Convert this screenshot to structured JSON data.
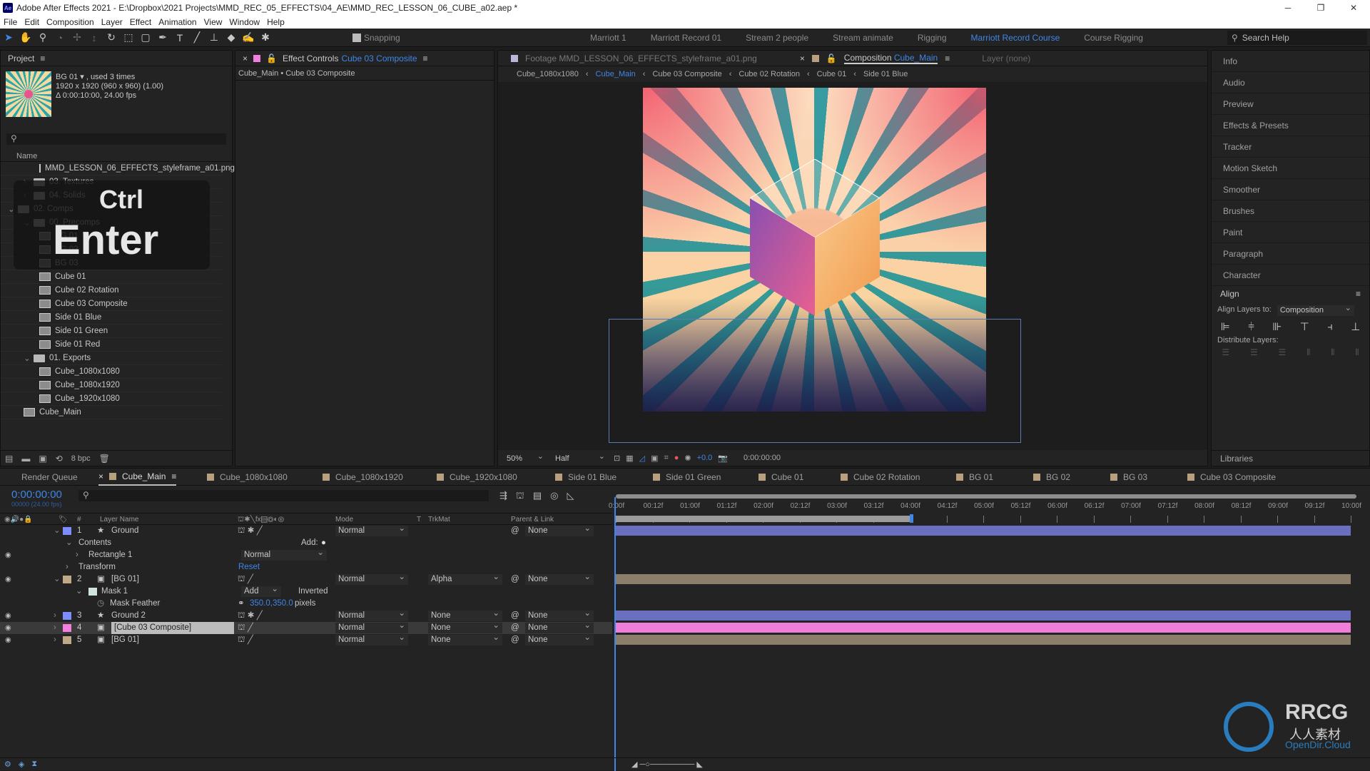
{
  "app": {
    "title": "Adobe After Effects 2021 - E:\\Dropbox\\2021 Projects\\MMD_REC_05_EFFECTS\\04_AE\\MMD_REC_LESSON_06_CUBE_a02.aep *",
    "logo": "Ae"
  },
  "menu": [
    "File",
    "Edit",
    "Composition",
    "Layer",
    "Effect",
    "Animation",
    "View",
    "Window",
    "Help"
  ],
  "toolbar": {
    "snapping": "Snapping",
    "workspaces": [
      "Marriott 1",
      "Marriott Record 01",
      "Stream 2 people",
      "Stream animate",
      "Rigging",
      "Marriott Record Course",
      "Course Rigging"
    ],
    "active_workspace": "Marriott Record Course",
    "search_help": "Search Help"
  },
  "project": {
    "title": "Project",
    "selected_name": "BG 01",
    "used": ", used 3 times",
    "dims": "1920 x 1920  (960 x 960) (1.00)",
    "duration": "Δ 0:00:10:00, 24.00 fps",
    "name_header": "Name",
    "bpc": "8 bpc",
    "items": [
      {
        "label": "MMD_LESSON_06_EFFECTS_styleframe_a01.png",
        "type": "footage",
        "indent": 2
      },
      {
        "label": "03. Textures",
        "type": "folder",
        "indent": 1
      },
      {
        "label": "04. Solids",
        "type": "folder",
        "indent": 1
      },
      {
        "label": "02. Comps",
        "type": "folder",
        "indent": 0
      },
      {
        "label": "00. Precomps",
        "type": "folder",
        "indent": 1
      },
      {
        "label": "BG 01",
        "type": "comp",
        "indent": 2
      },
      {
        "label": "BG 02",
        "type": "comp",
        "indent": 2
      },
      {
        "label": "BG 03",
        "type": "comp",
        "indent": 2
      },
      {
        "label": "Cube 01",
        "type": "comp",
        "indent": 2
      },
      {
        "label": "Cube 02 Rotation",
        "type": "comp",
        "indent": 2
      },
      {
        "label": "Cube 03 Composite",
        "type": "comp",
        "indent": 2
      },
      {
        "label": "Side 01 Blue",
        "type": "comp",
        "indent": 2
      },
      {
        "label": "Side 01 Green",
        "type": "comp",
        "indent": 2
      },
      {
        "label": "Side 01 Red",
        "type": "comp",
        "indent": 2
      },
      {
        "label": "01. Exports",
        "type": "folder",
        "indent": 1
      },
      {
        "label": "Cube_1080x1080",
        "type": "comp",
        "indent": 2
      },
      {
        "label": "Cube_1080x1920",
        "type": "comp",
        "indent": 2
      },
      {
        "label": "Cube_1920x1080",
        "type": "comp",
        "indent": 2
      },
      {
        "label": "Cube_Main",
        "type": "comp",
        "indent": 1
      }
    ]
  },
  "overlay": {
    "key1": "Ctrl",
    "key2": "Enter"
  },
  "effect_controls": {
    "title": "Effect Controls",
    "layer": "Cube 03 Composite",
    "path": "Cube_Main • Cube 03 Composite"
  },
  "viewer": {
    "footage_tab": "Footage MMD_LESSON_06_EFFECTS_styleframe_a01.png",
    "comp_tab_prefix": "Composition",
    "comp_tab_name": "Cube_Main",
    "layer_tab": "Layer (none)",
    "breadcrumbs": [
      "Cube_1080x1080",
      "Cube_Main",
      "Cube 03 Composite",
      "Cube 02 Rotation",
      "Cube 01",
      "Side 01 Blue"
    ],
    "active_crumb": "Cube_Main",
    "zoom": "50%",
    "resolution": "Half",
    "exposure": "+0.0",
    "timecode": "0:00:00:00"
  },
  "right_panel": {
    "items": [
      "Info",
      "Audio",
      "Preview",
      "Effects & Presets",
      "Tracker",
      "Motion Sketch",
      "Smoother",
      "Brushes",
      "Paint",
      "Paragraph",
      "Character"
    ],
    "align_title": "Align",
    "align_layers_to": "Align Layers to:",
    "align_target": "Composition",
    "distribute": "Distribute Layers:",
    "libraries": "Libraries"
  },
  "timeline": {
    "tabs": [
      "Render Queue",
      "Cube_Main",
      "Cube_1080x1080",
      "Cube_1080x1920",
      "Cube_1920x1080",
      "Side 01 Blue",
      "Side 01 Green",
      "Cube 01",
      "Cube 02 Rotation",
      "BG 01",
      "BG 02",
      "BG 03",
      "Cube 03 Composite"
    ],
    "active_tab": "Cube_Main",
    "timecode": "0:00:00:00",
    "frame_info": "00000 (24.00 fps)",
    "headers": {
      "num": "#",
      "layer_name": "Layer Name",
      "mode": "Mode",
      "t": "T",
      "trkmat": "TrkMat",
      "parent": "Parent & Link"
    },
    "ruler": [
      "0:00f",
      "00:12f",
      "01:00f",
      "01:12f",
      "02:00f",
      "02:12f",
      "03:00f",
      "03:12f",
      "04:00f",
      "04:12f",
      "05:00f",
      "05:12f",
      "06:00f",
      "06:12f",
      "07:00f",
      "07:12f",
      "08:00f",
      "08:12f",
      "09:00f",
      "09:12f",
      "10:00f"
    ],
    "work_area_end": "04:00f",
    "layers": [
      {
        "num": "1",
        "name": "Ground",
        "label_color": "#7d8cff",
        "mode": "Normal",
        "trkmat": "",
        "parent": "None",
        "bar_color": "#6b6fc0",
        "star": true
      },
      {
        "num": "2",
        "name": "[BG 01]",
        "label_color": "#bfa987",
        "mode": "Normal",
        "trkmat": "Alpha",
        "parent": "None",
        "bar_color": "#8b7f6b",
        "star": false
      },
      {
        "num": "3",
        "name": "Ground 2",
        "label_color": "#7d8cff",
        "mode": "Normal",
        "trkmat": "None",
        "parent": "None",
        "bar_color": "#6b6fc0",
        "star": true
      },
      {
        "num": "4",
        "name": "[Cube 03 Composite]",
        "label_color": "#f27fe0",
        "mode": "Normal",
        "trkmat": "None",
        "parent": "None",
        "bar_color": "#f07ed8",
        "star": false
      },
      {
        "num": "5",
        "name": "[BG 01]",
        "label_color": "#bfa987",
        "mode": "Normal",
        "trkmat": "None",
        "parent": "None",
        "bar_color": "#8b7f6b",
        "star": false
      }
    ],
    "props": {
      "contents": "Contents",
      "add": "Add:",
      "rectangle": "Rectangle 1",
      "rect_mode": "Normal",
      "transform": "Transform",
      "reset": "Reset",
      "mask": "Mask 1",
      "mask_mode": "Add",
      "inverted": "Inverted",
      "feather": "Mask Feather",
      "feather_val": "350.0,350.0",
      "pixels": "pixels"
    }
  },
  "watermark": {
    "brand": "RRCG",
    "sub": "人人素材",
    "site": "OpenDir.Cloud"
  }
}
